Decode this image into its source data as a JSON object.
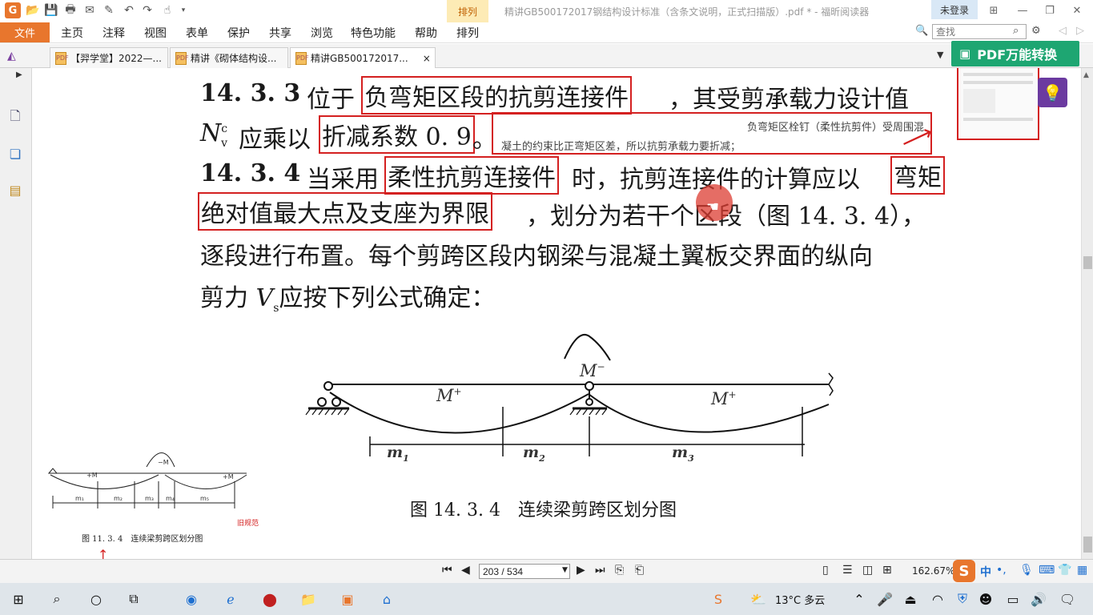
{
  "titlebar": {
    "logo": "G",
    "arrange_tab": "排列",
    "window_title": "精讲GB500172017钢结构设计标准（含条文说明，正式扫描版）.pdf * - 福昕阅读器",
    "login": "未登录",
    "quick_icons": [
      "open-folder-icon",
      "save-icon",
      "print-icon",
      "email-icon",
      "new-icon",
      "undo-icon",
      "redo-icon",
      "hand-tool-icon"
    ]
  },
  "menu": {
    "file": "文件",
    "items": [
      "主页",
      "注释",
      "视图",
      "表单",
      "保护",
      "共享",
      "浏览",
      "特色功能",
      "帮助",
      "排列"
    ],
    "search_placeholder": "查找"
  },
  "tabs": [
    {
      "label": "【羿学堂】2022—..."
    },
    {
      "label": "精讲《砌体结构设..."
    },
    {
      "label": "精讲GB500172017...",
      "close": "×"
    }
  ],
  "promo": {
    "label": "PDF万能转换"
  },
  "document": {
    "line1_num": "14. 3. 3",
    "line1_pre": "位于",
    "line1_hl": "负弯矩区段的抗剪连接件",
    "line1_post": "，其受剪承载力设计值",
    "line2_sym": "N",
    "line2_sup": "c",
    "line2_sub": "v",
    "line2_pre": "应乘以",
    "line2_hl": "折减系数 0. 9",
    "line2_post": "。",
    "note_line1": "负弯矩区栓钉（柔性抗剪件）受周围混",
    "note_line2": "凝土的约束比正弯矩区差，所以抗剪承载力要折减；",
    "line3_num": "14. 3. 4",
    "line3_pre": "当采用",
    "line3_hl": "柔性抗剪连接件",
    "line3_post": "时，抗剪连接件的计算应以",
    "line3_hl2": "弯矩",
    "line4_hl": "绝对值最大点及支座为界限",
    "line4_post": "，划分为若干个区段（图 14. 3. 4），",
    "line5": "逐段进行布置。每个剪跨区段内钢梁与混凝土翼板交界面的纵向",
    "line6_pre": "剪力",
    "line6_sym": "V",
    "line6_sub": "s",
    "line6_post": "应按下列公式确定：",
    "fig_labels": {
      "m_minus": "M",
      "m_minus_sup": "−",
      "m_plus1": "M",
      "m_plus2": "M",
      "plus_sup": "+",
      "m1": "m",
      "m2": "m",
      "m3": "m",
      "s1": "1",
      "s2": "2",
      "s3": "3"
    },
    "fig_caption": "图 14. 3. 4　连续梁剪跨区划分图",
    "old_fig_caption": "图 11. 3. 4　连续梁剪跨区划分图",
    "old_note": "旧规范",
    "old_labels": {
      "pm1": "+M",
      "mm": "−M",
      "pm2": "+M",
      "m1": "m₁",
      "m2": "m₂",
      "m3": "m₃",
      "m4": "m₄",
      "m5": "m₅"
    }
  },
  "status": {
    "page": "203 / 534",
    "zoom": "162.67%"
  },
  "taskbar": {
    "weather": "13°C  多云",
    "ime": "中"
  },
  "colors": {
    "accent": "#e8762d",
    "promo": "#1ea672",
    "highlight": "#d42020"
  }
}
